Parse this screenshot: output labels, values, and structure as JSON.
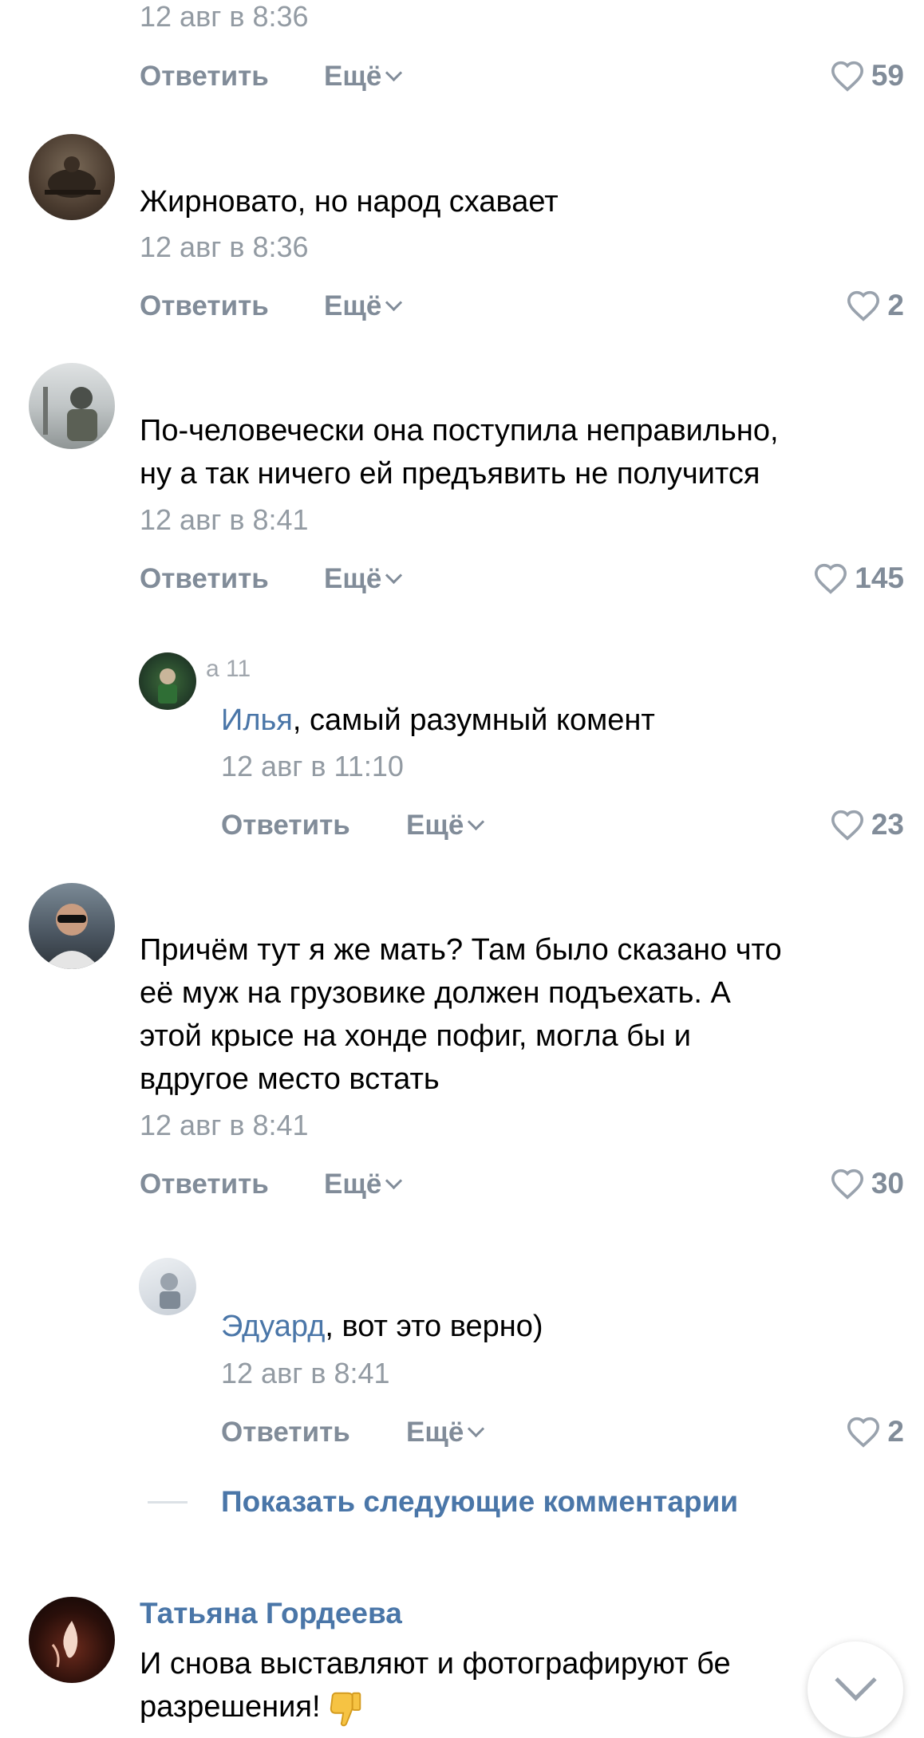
{
  "comments": [
    {
      "date": "12 авг в 8:36",
      "reply_label": "Ответить",
      "more_label": "Ещё",
      "likes": "59"
    },
    {
      "text": "Жирновато, но народ схавает",
      "date": "12 авг в 8:36",
      "reply_label": "Ответить",
      "more_label": "Ещё",
      "likes": "2"
    },
    {
      "text_line1": "По-человечески она поступила неправильно,",
      "text_line2": "ну а так ничего ей предъявить не получится",
      "date": "12 авг в 8:41",
      "reply_label": "Ответить",
      "more_label": "Ещё",
      "likes": "145"
    },
    {
      "author_fragment": "a 11",
      "mention": "Илья",
      "text": ", самый разумный комент",
      "date": "12 авг в 11:10",
      "reply_label": "Ответить",
      "more_label": "Ещё",
      "likes": "23"
    },
    {
      "text_line1": "Причём тут я же мать? Там было сказано что",
      "text_line2": "её муж на грузовике должен подъехать. А",
      "text_line3": "этой крысе на хонде пофиг, могла бы и",
      "text_line4": "вдругое место встать",
      "date": "12 авг в 8:41",
      "reply_label": "Ответить",
      "more_label": "Ещё",
      "likes": "30"
    },
    {
      "mention": "Эдуард",
      "text": ", вот это верно)",
      "date": "12 авг в 8:41",
      "reply_label": "Ответить",
      "more_label": "Ещё",
      "likes": "2"
    },
    {
      "author": "Татьяна Гордеева",
      "text_line1": "И снова выставляют и фотографируют бе",
      "text_line2": "разрешения!"
    }
  ],
  "show_more_label": "Показать следующие комментарии",
  "icons": {
    "like": "heart-icon",
    "chevron": "chevron-down-icon",
    "emoji": "thumbs-down-emoji"
  },
  "colors": {
    "link": "#4a76a8",
    "muted": "#818c99",
    "date": "#939ba3"
  }
}
